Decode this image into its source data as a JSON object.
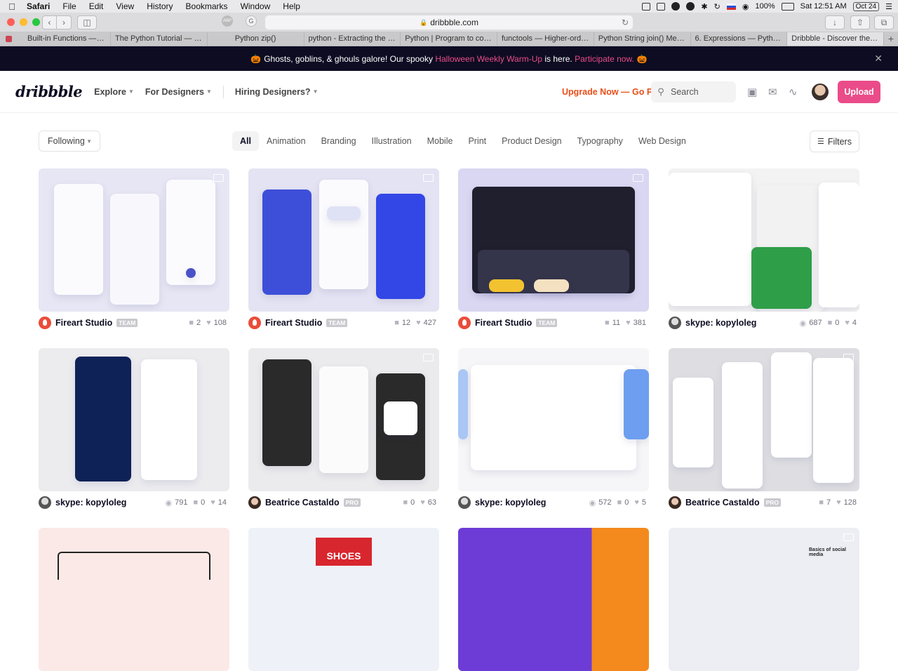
{
  "menubar": {
    "app": "Safari",
    "items": [
      "File",
      "Edit",
      "View",
      "History",
      "Bookmarks",
      "Window",
      "Help"
    ],
    "battery": "100%",
    "clock": "Sat 12:51 AM",
    "date_badge": "Oct 24"
  },
  "toolbar": {
    "url": "dribbble.com"
  },
  "tabs": [
    "Built-in Functions — Pytho...",
    "The Python Tutorial — Pyth...",
    "Python zip()",
    "python - Extracting the a v...",
    "Python | Program to conve...",
    "functools — Higher-order f...",
    "Python String join() Method",
    "6. Expressions — Python 3....",
    "Dribbble - Discover the Wo..."
  ],
  "banner": {
    "pre": "Ghosts, goblins, & ghouls galore! Our spooky ",
    "highlight": "Halloween Weekly Warm-Up",
    "mid": " is here. ",
    "cta": "Participate now.",
    "emoji": "🎃"
  },
  "header": {
    "logo": "dribbble",
    "nav": [
      "Explore",
      "For Designers",
      "Hiring Designers?"
    ],
    "upgrade": "Upgrade Now — Go Pro",
    "search_placeholder": "Search",
    "upload": "Upload"
  },
  "filter": {
    "following": "Following",
    "categories": [
      "All",
      "Animation",
      "Branding",
      "Illustration",
      "Mobile",
      "Print",
      "Product Design",
      "Typography",
      "Web Design"
    ],
    "filters": "Filters"
  },
  "shots": [
    {
      "author": "Fireart Studio",
      "badge": "TEAM",
      "comments": "2",
      "likes": "108",
      "bg": "#e7e6f4"
    },
    {
      "author": "Fireart Studio",
      "badge": "TEAM",
      "comments": "12",
      "likes": "427",
      "bg": "#e4e3f3"
    },
    {
      "author": "Fireart Studio",
      "badge": "TEAM",
      "comments": "11",
      "likes": "381",
      "bg": "#d9d7f1"
    },
    {
      "author": "skype: kopyloleg",
      "badge": "",
      "views": "687",
      "comments": "0",
      "likes": "4",
      "bg": "#f3f3f3"
    },
    {
      "author": "skype: kopyloleg",
      "badge": "",
      "views": "791",
      "comments": "0",
      "likes": "14",
      "bg": "#ececef"
    },
    {
      "author": "Beatrice Castaldo",
      "badge": "PRO",
      "comments": "0",
      "likes": "63",
      "bg": "#ebebed"
    },
    {
      "author": "skype: kopyloleg",
      "badge": "",
      "views": "572",
      "comments": "0",
      "likes": "5",
      "bg": "#f6f6f8"
    },
    {
      "author": "Beatrice Castaldo",
      "badge": "PRO",
      "comments": "7",
      "likes": "128",
      "bg": "#dedee2"
    }
  ],
  "row3_shot_text": [
    "SHOES",
    "Basics of social media"
  ]
}
